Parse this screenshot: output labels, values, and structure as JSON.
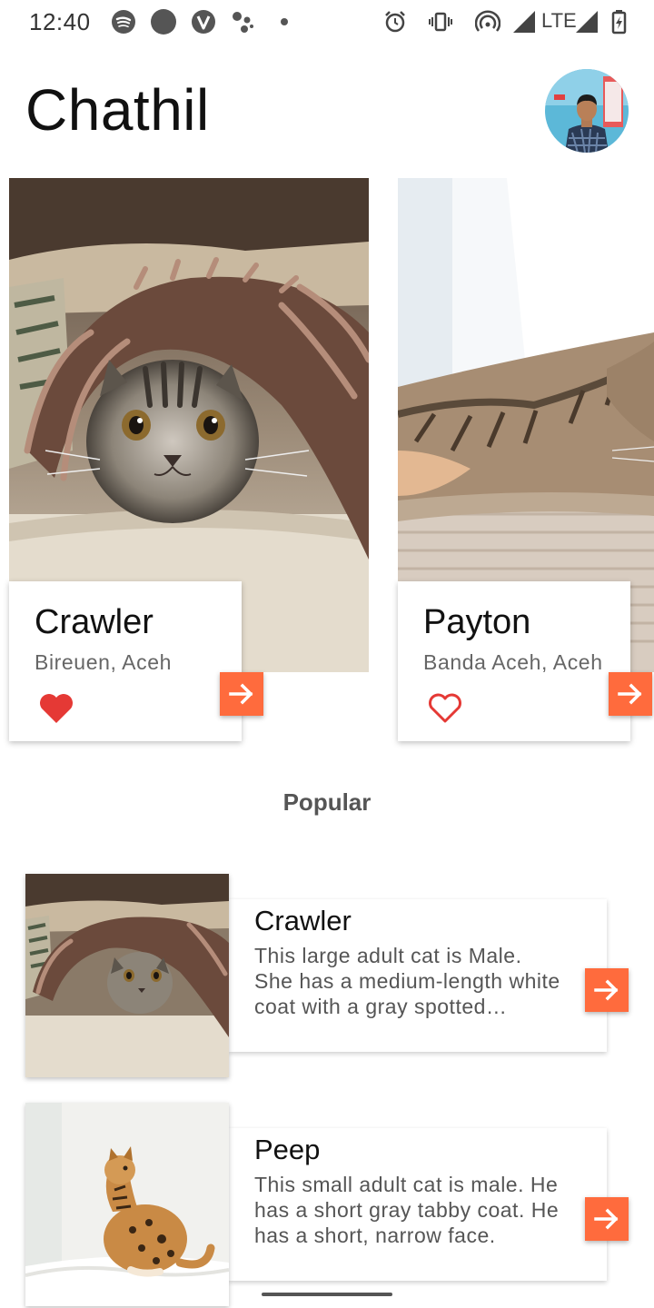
{
  "status_bar": {
    "time": "12:40",
    "network": "LTE",
    "icons": [
      "spotify-icon",
      "circle-notification-icon",
      "vivaldi-icon",
      "assistant-icon",
      "dot-icon",
      "alarm-icon",
      "vibrate-icon",
      "hotspot-icon",
      "signal-icon",
      "battery-charging-icon"
    ]
  },
  "header": {
    "title": "Chathil",
    "avatar": "profile-avatar"
  },
  "featured": [
    {
      "name": "Crawler",
      "location": "Bireuen, Aceh",
      "favorited": true
    },
    {
      "name": "Payton",
      "location": "Banda Aceh, Aceh",
      "favorited": false
    }
  ],
  "popular": {
    "title": "Popular",
    "items": [
      {
        "name": "Crawler",
        "description": "This large adult cat is Male. She has a medium-length white coat with a gray spotted pattern."
      },
      {
        "name": "Peep",
        "description": "This small adult cat is male. He has a short gray tabby coat.  He has a short, narrow face."
      }
    ]
  },
  "colors": {
    "accent": "#ff6b3d",
    "heart": "#e53935",
    "text": "#111111",
    "subtext": "#666666"
  }
}
